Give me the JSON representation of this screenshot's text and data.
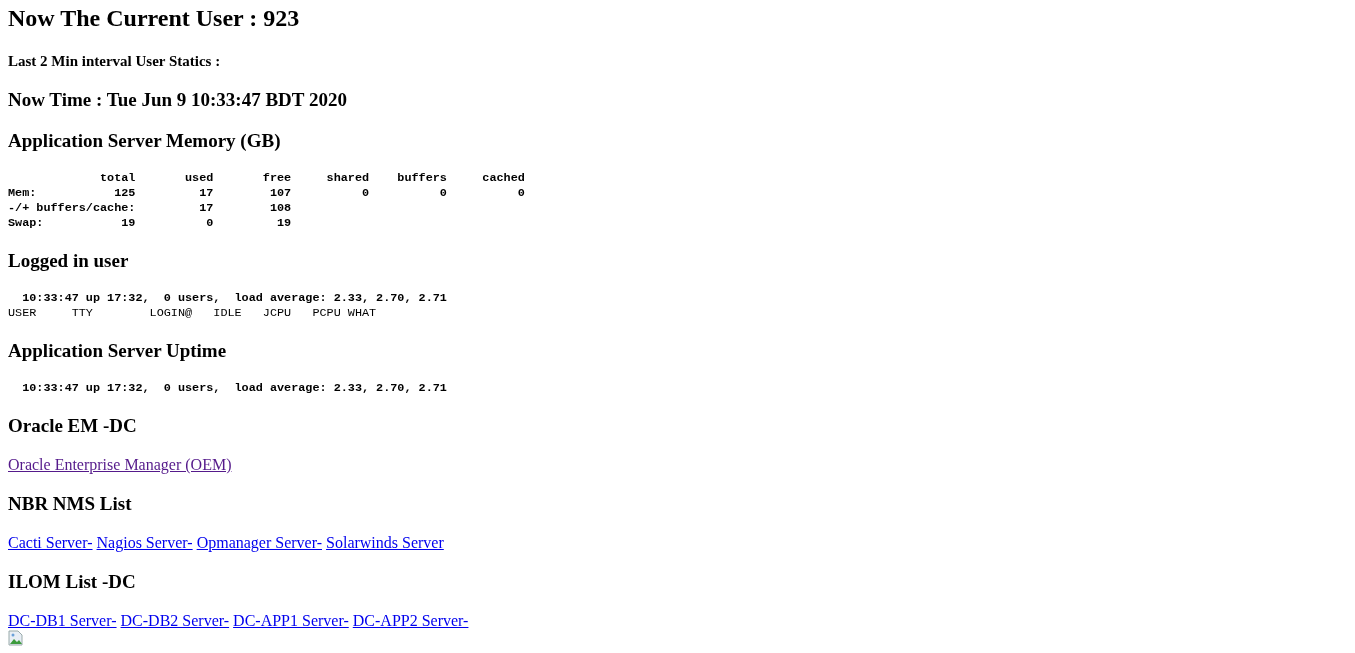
{
  "title": "Now The Current User : 923",
  "subtitle": "Last 2 Min interval User Statics :",
  "time": "Now Time : Tue Jun 9 10:33:47 BDT 2020",
  "sections": [
    {
      "heading": "Application Server Memory (GB)",
      "kind": "pre",
      "lines": [
        {
          "text": "             total       used       free     shared    buffers     cached",
          "bold": true
        },
        {
          "text": "Mem:           125         17        107          0          0          0",
          "bold": true
        },
        {
          "text": "-/+ buffers/cache:         17        108",
          "bold": true
        },
        {
          "text": "Swap:           19          0         19",
          "bold": true
        }
      ]
    },
    {
      "heading": "Logged in user",
      "kind": "pre",
      "lines": [
        {
          "text": "  10:33:47 up 17:32,  0 users,  load average: 2.33, 2.70, 2.71",
          "bold": true
        },
        {
          "text": "USER     TTY        LOGIN@   IDLE   JCPU   PCPU WHAT",
          "bold": false
        }
      ]
    },
    {
      "heading": "Application Server Uptime",
      "kind": "pre",
      "lines": [
        {
          "text": "  10:33:47 up 17:32,  0 users,  load average: 2.33, 2.70, 2.71",
          "bold": true
        }
      ]
    },
    {
      "heading": "Oracle EM -DC",
      "kind": "links",
      "links": [
        {
          "label": "Oracle Enterprise Manager (OEM)",
          "visited": true
        }
      ]
    },
    {
      "heading": "NBR NMS List",
      "kind": "links",
      "links": [
        {
          "label": "Cacti Server-",
          "visited": false
        },
        {
          "label": "Nagios Server-",
          "visited": false
        },
        {
          "label": "Opmanager Server-",
          "visited": false
        },
        {
          "label": "Solarwinds Server",
          "visited": false
        }
      ]
    },
    {
      "heading": "ILOM List -DC",
      "kind": "links",
      "links": [
        {
          "label": "DC-DB1 Server-",
          "visited": false
        },
        {
          "label": "DC-DB2 Server-",
          "visited": false
        },
        {
          "label": "DC-APP1 Server-",
          "visited": false
        },
        {
          "label": "DC-APP2 Server-",
          "visited": false
        }
      ]
    }
  ]
}
